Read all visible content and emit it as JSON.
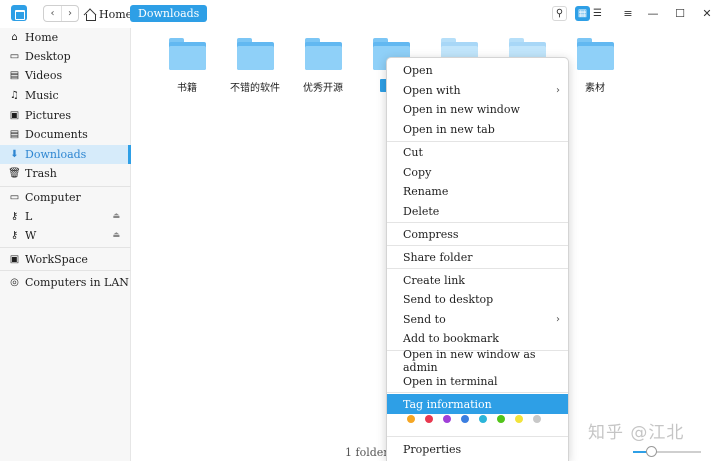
{
  "titlebar": {
    "back_glyph": "‹",
    "forward_glyph": "›",
    "home_label": "Home",
    "current_label": "Downloads",
    "search_glyph": "⚲",
    "icon_view_glyph": "▦",
    "list_view_glyph": "☰",
    "menu_glyph": "≡",
    "minimize_glyph": "—",
    "maximize_glyph": "☐",
    "close_glyph": "✕"
  },
  "sidebar": {
    "items": [
      {
        "label": "Home",
        "icon": "⌂",
        "icon_name": "home-icon"
      },
      {
        "label": "Desktop",
        "icon": "▭",
        "icon_name": "desktop-icon"
      },
      {
        "label": "Videos",
        "icon": "▤",
        "icon_name": "videos-icon"
      },
      {
        "label": "Music",
        "icon": "♫",
        "icon_name": "music-icon"
      },
      {
        "label": "Pictures",
        "icon": "▣",
        "icon_name": "pictures-icon"
      },
      {
        "label": "Documents",
        "icon": "▤",
        "icon_name": "documents-icon"
      },
      {
        "label": "Downloads",
        "icon": "⬇",
        "icon_name": "downloads-icon"
      },
      {
        "label": "Trash",
        "icon": "🗑",
        "icon_name": "trash-icon"
      },
      {
        "label": "Computer",
        "icon": "▭",
        "icon_name": "computer-icon"
      },
      {
        "label": "L",
        "icon": "⚷",
        "icon_name": "drive-icon"
      },
      {
        "label": "W",
        "icon": "⚷",
        "icon_name": "drive-icon"
      },
      {
        "label": "WorkSpace",
        "icon": "▣",
        "icon_name": "workspace-icon"
      },
      {
        "label": "Computers in LAN",
        "icon": "◎",
        "icon_name": "network-icon"
      }
    ],
    "eject_glyph": "⏏"
  },
  "folders": [
    {
      "label": "书籍"
    },
    {
      "label": "不错的软件"
    },
    {
      "label": "优秀开源"
    },
    {
      "label": ""
    },
    {
      "label": ""
    },
    {
      "label": ""
    },
    {
      "label": "素材"
    }
  ],
  "context_menu": {
    "items": [
      {
        "label": "Open"
      },
      {
        "label": "Open with"
      },
      {
        "label": "Open in new window"
      },
      {
        "label": "Open in new tab"
      },
      {
        "label": "Cut"
      },
      {
        "label": "Copy"
      },
      {
        "label": "Rename"
      },
      {
        "label": "Delete"
      },
      {
        "label": "Compress"
      },
      {
        "label": "Share folder"
      },
      {
        "label": "Create link"
      },
      {
        "label": "Send to desktop"
      },
      {
        "label": "Send to"
      },
      {
        "label": "Add to bookmark"
      },
      {
        "label": "Open in new window as admin"
      },
      {
        "label": "Open in terminal"
      },
      {
        "label": "Tag information"
      },
      {
        "label": "Properties"
      }
    ],
    "submenu_arrow": "›",
    "tag_colors": [
      "#f5a623",
      "#e8384f",
      "#a040d8",
      "#3b7ee0",
      "#2bb5d9",
      "#52c41a",
      "#f2e33b",
      "#c8c8c8"
    ]
  },
  "status": {
    "text": "1 folder s"
  },
  "zoom": {
    "level_fraction": 0.26
  },
  "watermark": {
    "text": "知乎 @江北"
  },
  "colors": {
    "accent": "#2e9fe6",
    "folder": "#62b8f1"
  }
}
